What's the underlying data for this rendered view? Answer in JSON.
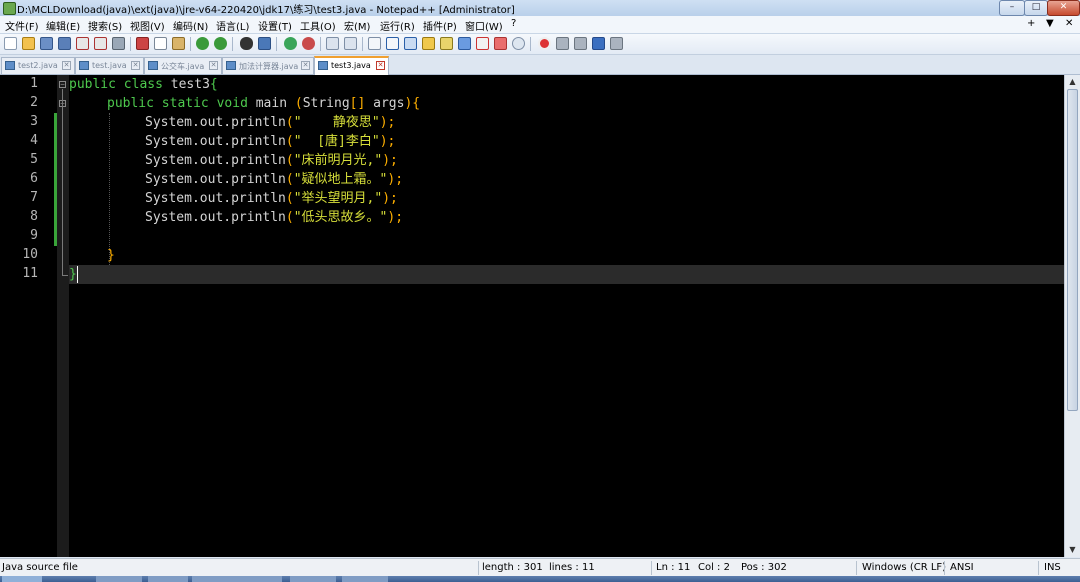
{
  "window": {
    "title": "D:\\MCLDownload(java)\\ext(java)\\jre-v64-220420\\jdk17\\练习\\test3.java - Notepad++ [Administrator]",
    "controls": {
      "minimize": "–",
      "maximize": "□",
      "close": "✕"
    }
  },
  "menu": {
    "items": [
      "文件(F)",
      "编辑(E)",
      "搜索(S)",
      "视图(V)",
      "编码(N)",
      "语言(L)",
      "设置(T)",
      "工具(O)",
      "宏(M)",
      "运行(R)",
      "插件(P)",
      "窗口(W)",
      "?"
    ],
    "right_controls": [
      "+",
      "▼",
      "✕"
    ]
  },
  "toolbar": {
    "icons": [
      "new-file-icon",
      "open-file-icon",
      "save-icon",
      "save-all-icon",
      "close-icon",
      "close-all-icon",
      "print-icon",
      "cut-icon",
      "copy-icon",
      "paste-icon",
      "undo-icon",
      "redo-icon",
      "find-icon",
      "replace-icon",
      "zoom-in-icon",
      "zoom-out-icon",
      "sync-vertical-icon",
      "sync-horizontal-icon",
      "word-wrap-icon",
      "show-all-chars-icon",
      "indent-guide-icon",
      "user-lang-icon",
      "doc-map-icon",
      "function-list-icon",
      "folder-workspace-icon",
      "monitoring-icon",
      "doc-switcher-icon",
      "record-macro-icon",
      "stop-record-icon",
      "play-macro-icon",
      "run-macro-multiple-icon",
      "save-macro-icon"
    ]
  },
  "tabs": [
    {
      "label": "test2.java",
      "active": false
    },
    {
      "label": "test.java",
      "active": false
    },
    {
      "label": "公交车.java",
      "active": false
    },
    {
      "label": "加法计算器.java",
      "active": false
    },
    {
      "label": "test3.java",
      "active": true
    }
  ],
  "editor": {
    "line_numbers": [
      "1",
      "2",
      "3",
      "4",
      "5",
      "6",
      "7",
      "8",
      "9",
      "10",
      "11"
    ],
    "lines": [
      {
        "kw1": "public",
        "kw2": "class",
        "name": "test3",
        "open": "{"
      },
      {
        "kw1": "public",
        "kw2": "static",
        "kw3": "void",
        "name": "main",
        "sig_open": "(",
        "type": "String",
        "arr": "[]",
        "arg": "args",
        "sig_close": ")",
        "open": "{"
      },
      {
        "call": "System.out.println",
        "lp": "(",
        "str": "\"    静夜思\"",
        "rp": ")",
        "semi": ";"
      },
      {
        "call": "System.out.println",
        "lp": "(",
        "str": "\"  [唐]李白\"",
        "rp": ")",
        "semi": ";"
      },
      {
        "call": "System.out.println",
        "lp": "(",
        "str": "\"床前明月光,\"",
        "rp": ")",
        "semi": ";"
      },
      {
        "call": "System.out.println",
        "lp": "(",
        "str": "\"疑似地上霜。\"",
        "rp": ")",
        "semi": ";"
      },
      {
        "call": "System.out.println",
        "lp": "(",
        "str": "\"举头望明月,\"",
        "rp": ")",
        "semi": ";"
      },
      {
        "call": "System.out.println",
        "lp": "(",
        "str": "\"低头思故乡。\"",
        "rp": ")",
        "semi": ";"
      },
      {},
      {
        "close": "}"
      },
      {
        "close": "}"
      }
    ],
    "colors": {
      "keyword": "#4ec94e",
      "bracket": "#ffb000",
      "string": "#d7df3a",
      "background": "#000000"
    }
  },
  "status": {
    "file_type": "Java source file",
    "length": "length : 301",
    "lines": "lines : 11",
    "ln": "Ln : 11",
    "col": "Col : 2",
    "pos": "Pos : 302",
    "eol": "Windows (CR LF)",
    "encoding": "ANSI",
    "mode": "INS"
  }
}
